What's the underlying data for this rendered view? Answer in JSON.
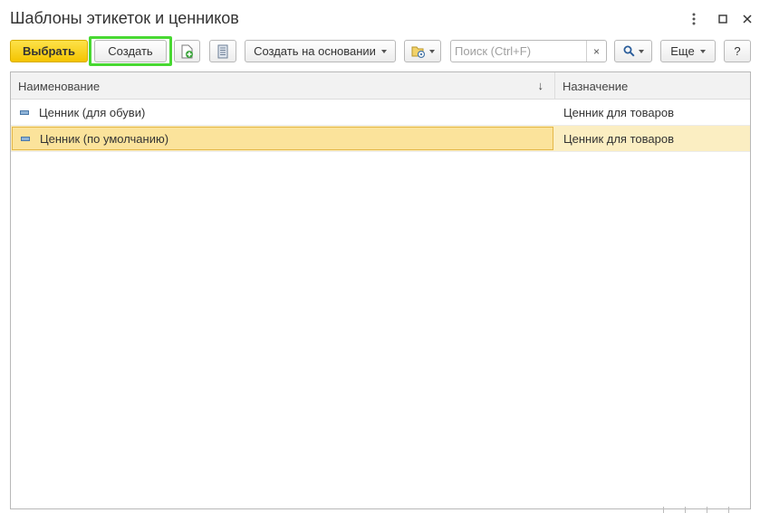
{
  "window": {
    "title": "Шаблоны этикеток и ценников"
  },
  "toolbar": {
    "select_label": "Выбрать",
    "create_label": "Создать",
    "create_based_label": "Создать на основании",
    "search_placeholder": "Поиск (Ctrl+F)",
    "search_value": "",
    "clear_label": "×",
    "more_label": "Еще",
    "help_label": "?"
  },
  "table": {
    "columns": [
      "Наименование",
      "Назначение"
    ],
    "sort_indicator": "↓",
    "rows": [
      {
        "name": "Ценник (для обуви)",
        "purpose": "Ценник для товаров",
        "selected": false
      },
      {
        "name": "Ценник (по умолчанию)",
        "purpose": "Ценник для товаров",
        "selected": true
      }
    ]
  },
  "colors": {
    "primary_button": "#f4c400",
    "highlight_border": "#48d832",
    "selected_row": "#fbe39b"
  },
  "icons": [
    "more-vertical-icon",
    "maximize-icon",
    "close-icon",
    "add-copy-icon",
    "list-icon",
    "report-settings-icon",
    "search-icon",
    "item-icon"
  ]
}
